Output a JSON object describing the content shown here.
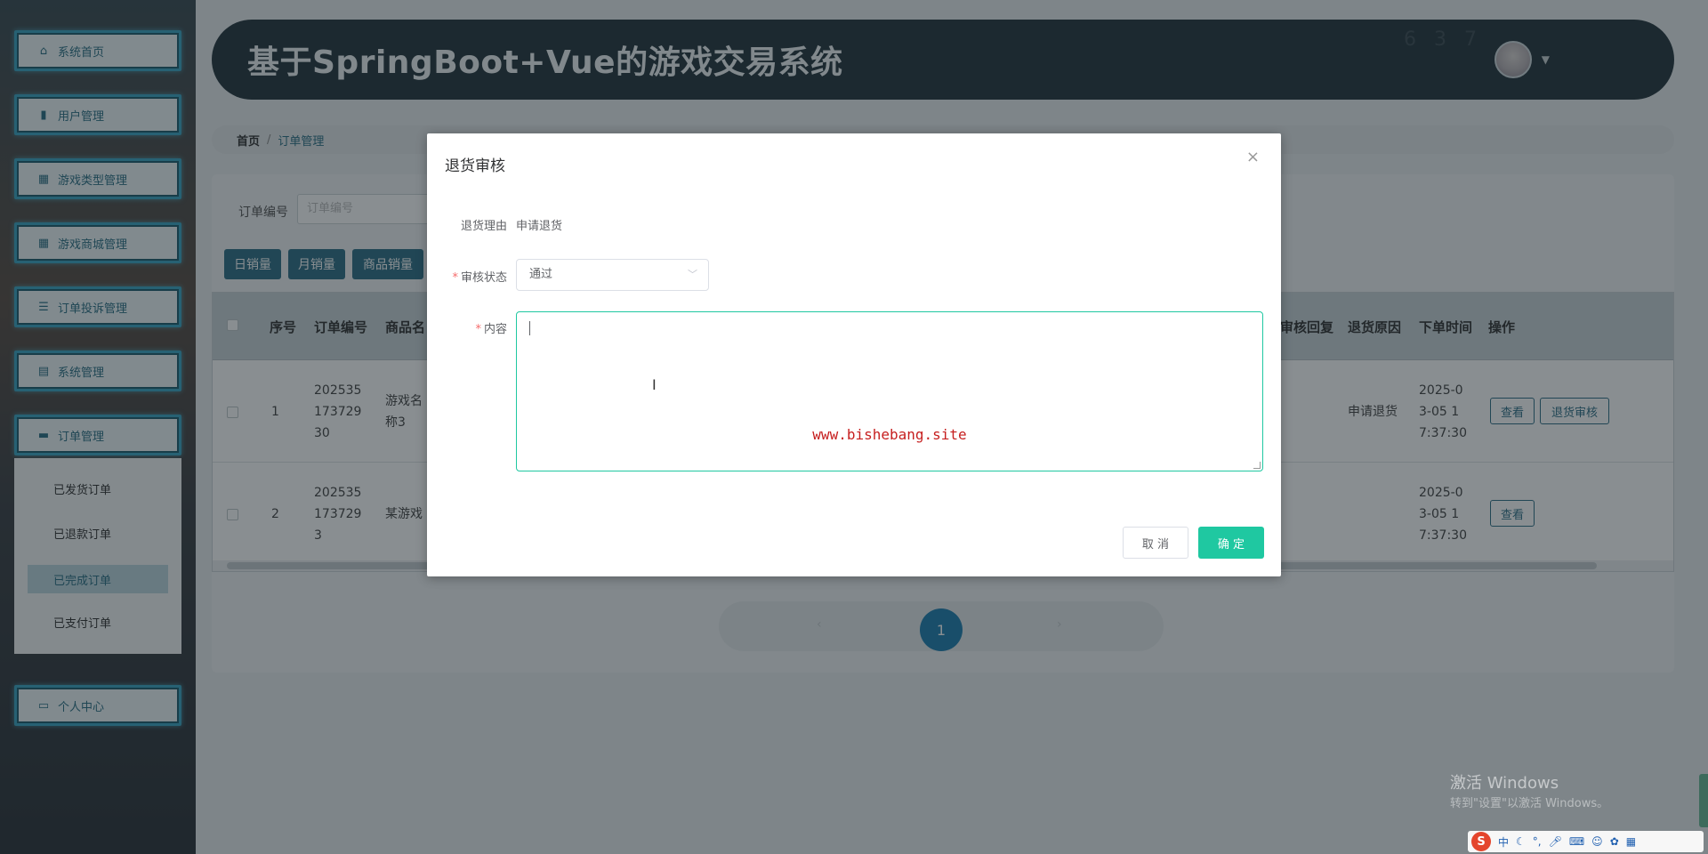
{
  "sidebar": {
    "items": [
      {
        "label": "系统首页",
        "icon": "home-icon"
      },
      {
        "label": "用户管理",
        "icon": "bar-chart-icon"
      },
      {
        "label": "游戏类型管理",
        "icon": "grid-icon"
      },
      {
        "label": "游戏商城管理",
        "icon": "grid-icon"
      },
      {
        "label": "订单投诉管理",
        "icon": "list-icon"
      },
      {
        "label": "系统管理",
        "icon": "table-icon"
      },
      {
        "label": "订单管理",
        "icon": "monitor-icon"
      },
      {
        "label": "个人中心",
        "icon": "profile-icon"
      }
    ],
    "submenu": [
      "已发货订单",
      "已退款订单",
      "已完成订单",
      "已支付订单"
    ]
  },
  "header": {
    "title": "基于SpringBoot+Vue的游戏交易系统"
  },
  "breadcrumb": {
    "home": "首页",
    "sep": "/",
    "current": "订单管理"
  },
  "search": {
    "label": "订单编号",
    "placeholder": "订单编号"
  },
  "toolbar": {
    "day_sales": "日销量",
    "month_sales": "月销量",
    "product_sales": "商品销量"
  },
  "table": {
    "headers": {
      "index": "序号",
      "order_no": "订单编号",
      "product": "商品名",
      "review_reply": "审核回复",
      "reason": "退货原因",
      "order_time": "下单时间",
      "action": "操作"
    },
    "rows": [
      {
        "index": "1",
        "order_no": [
          "202535",
          "173729",
          "30"
        ],
        "product": [
          "游戏名",
          "称3"
        ],
        "reason": "申请退货",
        "time": [
          "2025-0",
          "3-05 1",
          "7:37:30"
        ],
        "view": "查看",
        "review": "退货审核"
      },
      {
        "index": "2",
        "order_no": [
          "202535",
          "173729",
          "3"
        ],
        "product": [
          "某游戏"
        ],
        "reason": "",
        "time": [
          "2025-0",
          "3-05 1",
          "7:37:30"
        ],
        "view": "查看"
      }
    ]
  },
  "pagination": {
    "page": "1"
  },
  "dialog": {
    "title": "退货审核",
    "reason_label": "退货理由",
    "reason_value": "申请退货",
    "status_label": "审核状态",
    "status_value": "通过",
    "content_label": "内容",
    "watermark": "www.bishebang.site",
    "cancel": "取 消",
    "confirm": "确 定"
  },
  "windows": {
    "activate_title": "激活 Windows",
    "activate_sub": "转到\"设置\"以激活 Windows。"
  },
  "tray": {
    "ime": "S",
    "lang": "中"
  }
}
